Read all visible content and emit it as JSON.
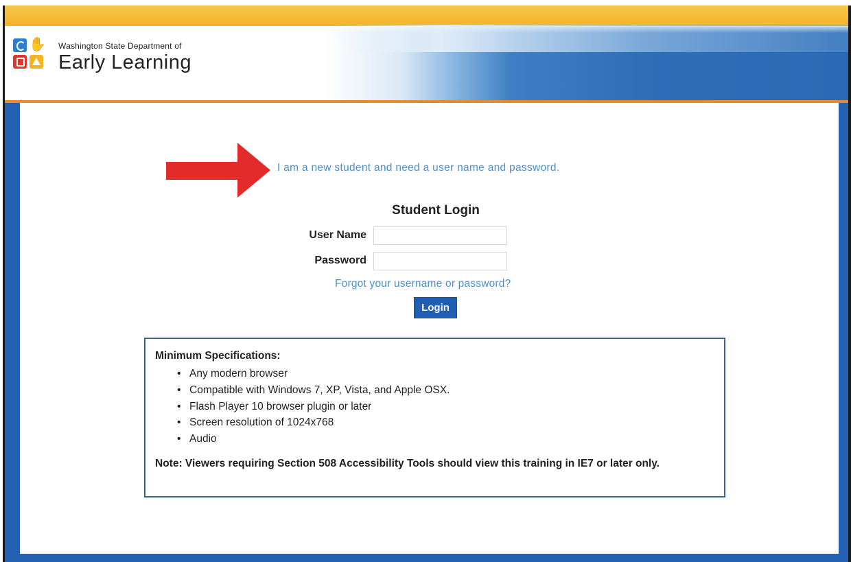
{
  "header": {
    "org_line": "Washington State Department of",
    "org_name": "Early Learning",
    "colors": {
      "stripe": "#f3b32b",
      "blue": "#2361b2",
      "accent": "#e88a2b"
    },
    "logo_icons": [
      "circle-icon",
      "hand-icon",
      "square-icon",
      "triangle-icon"
    ]
  },
  "main": {
    "arrow_icon": "red-right-arrow-icon",
    "new_student_link": "I am a new student and need a user name and password.",
    "login": {
      "title": "Student Login",
      "username_label": "User Name",
      "username_value": "",
      "password_label": "Password",
      "password_value": "",
      "forgot_link": "Forgot your username or password?",
      "submit_label": "Login"
    },
    "specs": {
      "title": "Minimum Specifications:",
      "items": [
        "Any modern browser",
        "Compatible with Windows 7, XP, Vista, and Apple OSX.",
        "Flash Player 10 browser plugin or later",
        "Screen resolution of 1024x768",
        "Audio"
      ],
      "note": "Note: Viewers requiring Section 508 Accessibility Tools should view this training in IE7 or later only."
    }
  }
}
